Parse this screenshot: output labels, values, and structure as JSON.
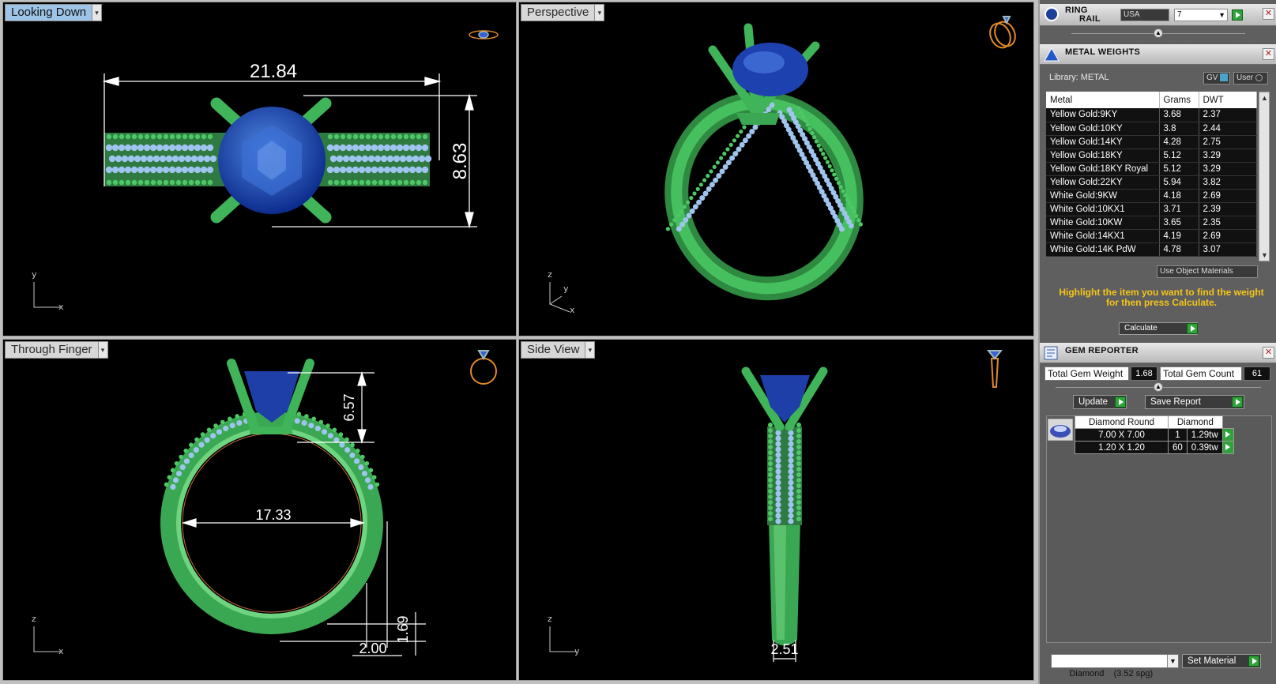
{
  "viewports": {
    "top_left": {
      "title": "Looking Down",
      "dims": [
        "21.84",
        "8.63"
      ],
      "axis": [
        "y",
        "x"
      ]
    },
    "top_right": {
      "title": "Perspective",
      "axis": [
        "z",
        "y",
        "x"
      ]
    },
    "bottom_left": {
      "title": "Through Finger",
      "dims": [
        "6.57",
        "17.33",
        "1.69",
        "2.00"
      ],
      "axis": [
        "z",
        "x"
      ]
    },
    "bottom_right": {
      "title": "Side View",
      "dims": [
        "2.51"
      ],
      "axis": [
        "z",
        "y"
      ]
    }
  },
  "ring_rail": {
    "title_line1": "RING",
    "title_line2": "RAIL",
    "country": "USA",
    "size": "7"
  },
  "metal_weights": {
    "title": "METAL WEIGHTS",
    "library_label": "Library: METAL",
    "gv_label": "GV",
    "user_label": "User",
    "columns": [
      "Metal",
      "Grams",
      "DWT"
    ],
    "rows": [
      [
        "Yellow Gold:9KY",
        "3.68",
        "2.37"
      ],
      [
        "Yellow Gold:10KY",
        "3.8",
        "2.44"
      ],
      [
        "Yellow Gold:14KY",
        "4.28",
        "2.75"
      ],
      [
        "Yellow Gold:18KY",
        "5.12",
        "3.29"
      ],
      [
        "Yellow Gold:18KY Royal",
        "5.12",
        "3.29"
      ],
      [
        "Yellow Gold:22KY",
        "5.94",
        "3.82"
      ],
      [
        "White Gold:9KW",
        "4.18",
        "2.69"
      ],
      [
        "White Gold:10KX1",
        "3.71",
        "2.39"
      ],
      [
        "White Gold:10KW",
        "3.65",
        "2.35"
      ],
      [
        "White Gold:14KX1",
        "4.19",
        "2.69"
      ],
      [
        "White Gold:14K PdW",
        "4.78",
        "3.07"
      ]
    ],
    "use_object_materials": "Use Object Materials",
    "instruction_line1": "Highlight the item you want to find the weight",
    "instruction_line2": "for then press Calculate.",
    "calculate_label": "Calculate"
  },
  "gem_reporter": {
    "title": "GEM REPORTER",
    "total_weight_label": "Total Gem Weight",
    "total_weight_value": "1.68",
    "total_count_label": "Total Gem Count",
    "total_count_value": "61",
    "update_label": "Update",
    "save_report_label": "Save Report",
    "group_header": [
      "Diamond Round",
      "Diamond"
    ],
    "rows": [
      [
        "7.00 X 7.00",
        "1",
        "1.29tw"
      ],
      [
        "1.20 X 1.20",
        "60",
        "0.39tw"
      ]
    ],
    "material_select": "Diamond    (3.52 spg)",
    "set_material_label": "Set Material"
  },
  "colors": {
    "ring_green": "#3fb458",
    "gem_blue": "#2045b8",
    "accent_yellow": "#f5c518",
    "viewport_bg": "#000000"
  }
}
